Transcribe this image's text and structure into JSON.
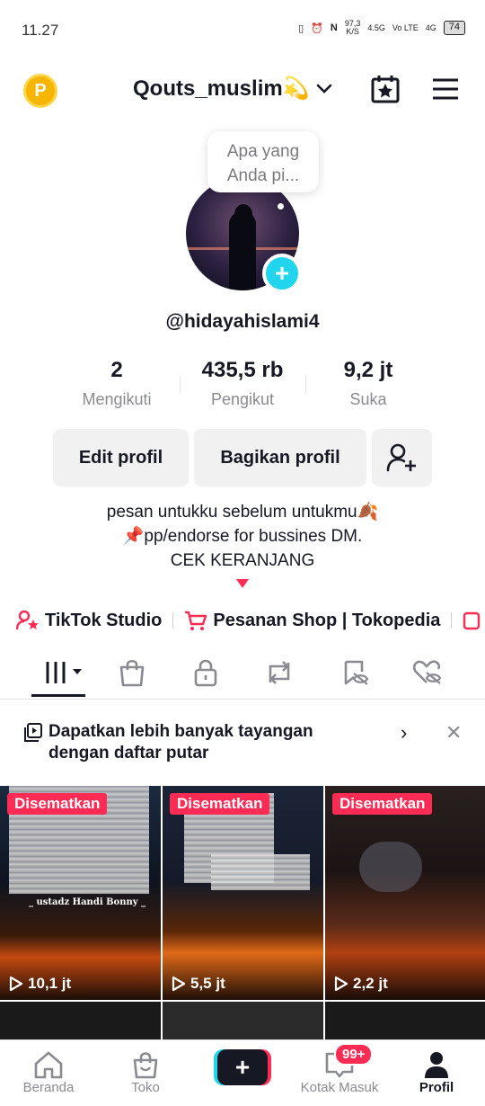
{
  "status_bar": {
    "time": "11.27",
    "net_speed": "97,3",
    "net_unit": "K/S",
    "signal1": "4.5G",
    "volte": "Vo LTE",
    "signal2": "4G",
    "battery": "74"
  },
  "header": {
    "coin_letter": "P",
    "username": "Qouts_muslim💫",
    "icons": [
      "coin-icon",
      "calendar-star-icon",
      "menu-icon",
      "chevron-down-icon"
    ]
  },
  "profile": {
    "bubble_text_1": "Apa yang",
    "bubble_text_2": "Anda pi...",
    "handle": "@hidayahislami4",
    "stats": [
      {
        "value": "2",
        "label": "Mengikuti"
      },
      {
        "value": "435,5 rb",
        "label": "Pengikut"
      },
      {
        "value": "9,2 jt",
        "label": "Suka"
      }
    ],
    "buttons": {
      "edit": "Edit profil",
      "share": "Bagikan profil"
    },
    "bio": {
      "line1": "pesan untukku sebelum untukmu🍂",
      "line2": "📌pp/endorse for bussines DM.",
      "line3": "CEK KERANJANG"
    },
    "links": {
      "studio": "TikTok Studio",
      "shop": "Pesanan Shop | Tokopedia"
    }
  },
  "tabs": [
    "videos-grid-icon",
    "shopping-bag-icon",
    "lock-icon",
    "repost-icon",
    "saved-icon",
    "liked-icon"
  ],
  "playlist_banner": {
    "line1": "Dapatkan lebih banyak tayangan",
    "line2": "dengan daftar putar"
  },
  "videos": [
    {
      "pinned": "Disematkan",
      "views": "10,1 jt",
      "caption": "_ ustadz Handi Bonny _"
    },
    {
      "pinned": "Disematkan",
      "views": "5,5 jt"
    },
    {
      "pinned": "Disematkan",
      "views": "2,2 jt"
    }
  ],
  "bottom_nav": {
    "home": "Beranda",
    "shop": "Toko",
    "inbox": "Kotak Masuk",
    "inbox_badge": "99+",
    "profile": "Profil"
  },
  "colors": {
    "accent_red": "#fe2c55",
    "accent_cyan": "#20d5ec",
    "text_dark": "#161823",
    "text_muted": "#8a8b91"
  }
}
